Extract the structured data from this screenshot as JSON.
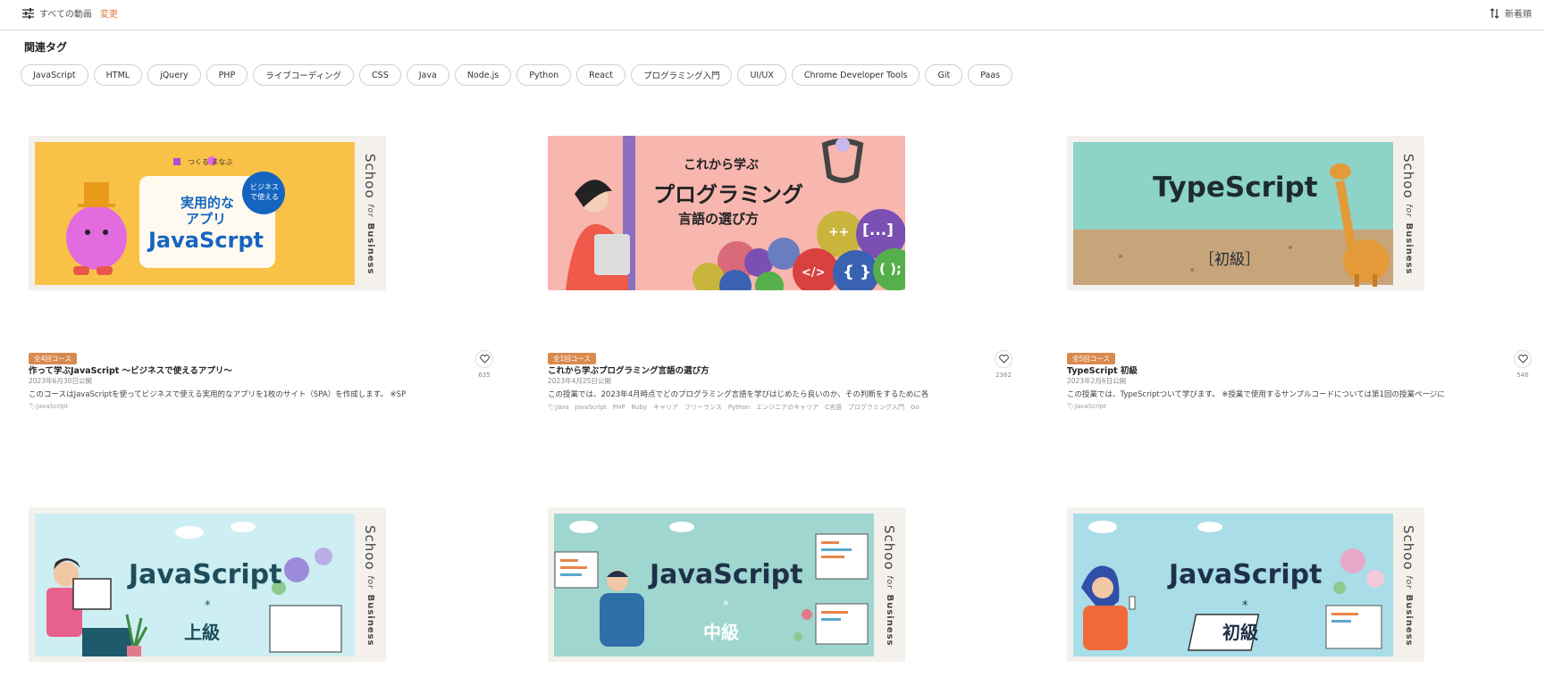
{
  "filter": {
    "label": "すべての動画",
    "change": "変更"
  },
  "sort": {
    "label": "新着順"
  },
  "section": {
    "title": "関連タグ"
  },
  "tags": [
    "JavaScript",
    "HTML",
    "jQuery",
    "PHP",
    "ライブコーディング",
    "CSS",
    "Java",
    "Node.js",
    "Python",
    "React",
    "プログラミング入門",
    "UI/UX",
    "Chrome Developer Tools",
    "Git",
    "Paas"
  ],
  "brand": {
    "schoo": "Schoo",
    "for": "for",
    "business": "Business"
  },
  "cards": [
    {
      "badge": "全4回コース",
      "title": "作って学ぶJavaScript ～ビジネスで使えるアプリ～",
      "date": "2023年6月30日公開",
      "desc": "このコースはJavaScriptを使ってビジネスで使える実用的なアプリを1枚のサイト（SPA）を作成します。 ※SP",
      "tags": "JavaScript",
      "likes": "635",
      "thumb": {
        "brand": "つくる まなぶ",
        "line1": "実用的な",
        "line2": "アプリ",
        "line3": "JavaScrpt",
        "bubble1": "ビジネス",
        "bubble2": "で使える"
      }
    },
    {
      "badge": "全1回コース",
      "title": "これから学ぶプログラミング言語の選び方",
      "date": "2023年4月25日公開",
      "desc": "この授業では、2023年4月時点でどのプログラミング言語を学びはじめたら良いのか、その判断をするために各",
      "tags": "Java　JavaScript　PHP　Ruby　キャリア　フリーランス　Python　エンジニアのキャリア　C言語　プログラミング入門　Go",
      "likes": "2362",
      "thumb": {
        "line1": "これから学ぶ",
        "line2": "プログラミング",
        "line3": "言語の選び方",
        "b1": "++",
        "b2": "[...]",
        "b3": "</>",
        "b4": "{ }",
        "b5": "( );"
      }
    },
    {
      "badge": "全5回コース",
      "title": "TypeScript 初級",
      "date": "2023年2月6日公開",
      "desc": "この授業では、TypeScriptついて学びます。 ※授業で使用するサンプルコードについては第1回の授業ページに",
      "tags": "JavaScript",
      "likes": "546",
      "thumb": {
        "line1": "TypeScript",
        "line2": "［初級］"
      }
    },
    {
      "thumb": {
        "line1": "JavaScript",
        "star": "*",
        "line2": "上級"
      }
    },
    {
      "thumb": {
        "line1": "JavaScript",
        "star": "*",
        "line2": "中級"
      }
    },
    {
      "thumb": {
        "line1": "JavaScript",
        "star": "*",
        "line2": "初級"
      }
    }
  ],
  "colors": {
    "accent": "#e07a3a",
    "badge": "#d98a4e"
  }
}
